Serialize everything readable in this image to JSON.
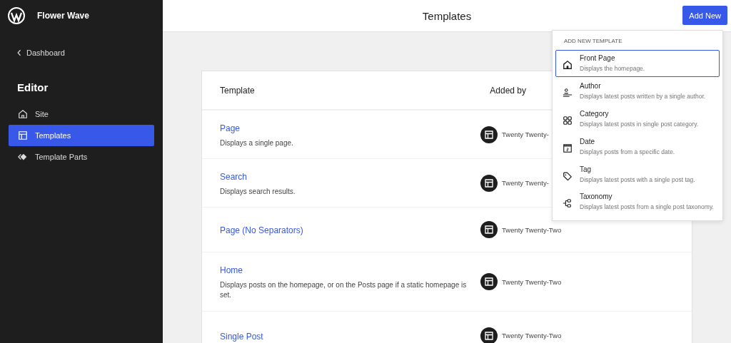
{
  "site": {
    "name": "Flower Wave"
  },
  "sidebar": {
    "back": "Dashboard",
    "heading": "Editor",
    "items": [
      {
        "label": "Site",
        "selected": false
      },
      {
        "label": "Templates",
        "selected": true
      },
      {
        "label": "Template Parts",
        "selected": false
      }
    ]
  },
  "header": {
    "title": "Templates",
    "add_button": "Add New"
  },
  "table": {
    "columns": [
      "Template",
      "Added by"
    ],
    "rows": [
      {
        "name": "Page",
        "description": "Displays a single page.",
        "added_by": "Twenty Twenty-"
      },
      {
        "name": "Search",
        "description": "Displays search results.",
        "added_by": "Twenty Twenty-"
      },
      {
        "name": "Page (No Separators)",
        "added_by": "Twenty Twenty-Two"
      },
      {
        "name": "Home",
        "description": "Displays posts on the homepage, or on the Posts page if a static homepage is set.",
        "added_by": "Twenty Twenty-Two"
      },
      {
        "name": "Single Post",
        "added_by": "Twenty Twenty-Two"
      }
    ]
  },
  "dropdown": {
    "heading": "ADD NEW TEMPLATE",
    "items": [
      {
        "title": "Front Page",
        "description": "Displays the homepage.",
        "selected": true
      },
      {
        "title": "Author",
        "description": "Displays latest posts written by a single author.",
        "selected": false
      },
      {
        "title": "Category",
        "description": "Displays latest posts in single post category.",
        "selected": false
      },
      {
        "title": "Date",
        "description": "Displays posts from a specific date.",
        "selected": false
      },
      {
        "title": "Tag",
        "description": "Displays latest posts with a single post tag.",
        "selected": false
      },
      {
        "title": "Taxonomy",
        "description": "Displays latest posts from a single post taxonomy.",
        "selected": false
      }
    ]
  }
}
